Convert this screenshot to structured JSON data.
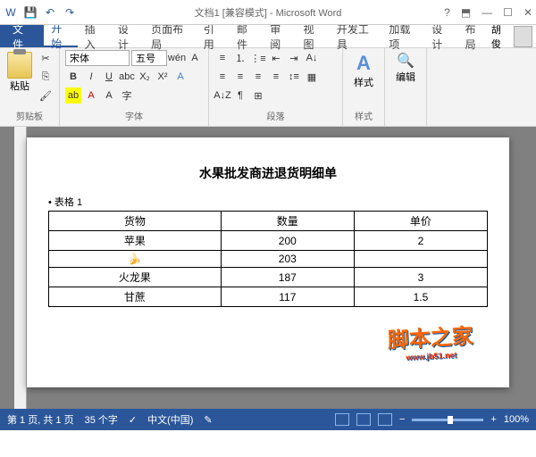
{
  "titlebar": {
    "title": "文档1 [兼容模式] - Microsoft Word"
  },
  "tabs": {
    "file": "文件",
    "items": [
      "开始",
      "插入",
      "设计",
      "页面布局",
      "引用",
      "邮件",
      "审阅",
      "视图",
      "开发工具",
      "加载项",
      "设计",
      "布局"
    ],
    "active": 0,
    "user": "胡俊"
  },
  "ribbon": {
    "clipboard": {
      "paste": "粘贴",
      "label": "剪贴板"
    },
    "font": {
      "family": "宋体",
      "size": "五号",
      "bold": "B",
      "italic": "I",
      "underline": "U",
      "label": "字体"
    },
    "paragraph": {
      "label": "段落"
    },
    "styles": {
      "btn": "样式",
      "label": "样式"
    },
    "editing": {
      "btn": "编辑"
    }
  },
  "document": {
    "title": "水果批发商进退货明细单",
    "table_label": "• 表格 1",
    "headers": [
      "货物",
      "数量",
      "单价"
    ],
    "rows": [
      [
        "苹果",
        "200",
        "2"
      ],
      [
        "🍌",
        "203",
        ""
      ],
      [
        "火龙果",
        "187",
        "3"
      ],
      [
        "甘蔗",
        "117",
        "1.5"
      ]
    ]
  },
  "watermark": {
    "main": "脚本之家",
    "sub": "www.jb51.net"
  },
  "statusbar": {
    "page": "第 1 页, 共 1 页",
    "words": "35 个字",
    "lang": "中文(中国)",
    "zoom": "100%"
  }
}
